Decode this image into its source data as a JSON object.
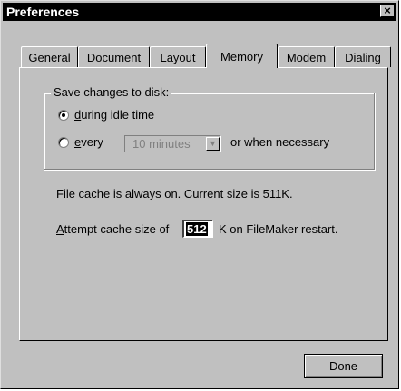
{
  "window": {
    "title": "Preferences",
    "close_glyph": "×"
  },
  "tabs": [
    {
      "label": "General"
    },
    {
      "label": "Document"
    },
    {
      "label": "Layout"
    },
    {
      "label": "Memory",
      "active": true
    },
    {
      "label": "Modem"
    },
    {
      "label": "Dialing"
    }
  ],
  "save_group": {
    "label": "Save changes to disk:",
    "option_idle": {
      "label_u": "d",
      "label_rest": "uring idle time",
      "selected": true
    },
    "option_every": {
      "label_u": "e",
      "label_rest": "very",
      "selected": false
    },
    "interval_value": "10 minutes",
    "or_when_label": "or when necessary"
  },
  "cache_info": "File cache is always on.  Current size is 511K.",
  "cache_size": {
    "label_u": "A",
    "label_rest": "ttempt cache size of",
    "value": "512",
    "suffix": "K on FileMaker restart."
  },
  "buttons": {
    "done": "Done"
  },
  "icons": {
    "close": "close-icon",
    "radio": "radio-icon",
    "dropdown": "chevron-down-icon"
  }
}
